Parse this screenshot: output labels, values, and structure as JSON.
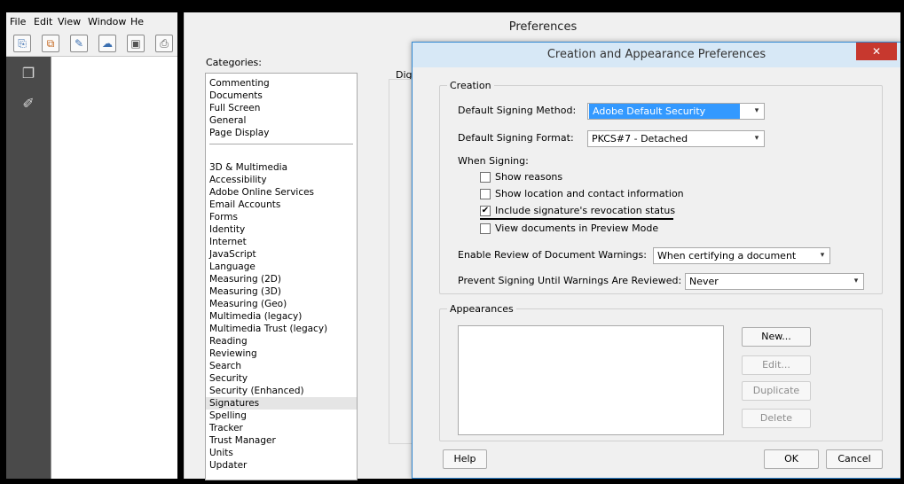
{
  "menu": {
    "file": "File",
    "edit": "Edit",
    "view": "View",
    "window": "Window",
    "help": "He"
  },
  "preferences": {
    "title": "Preferences",
    "categories_label": "Categories:",
    "digital_label": "Dig",
    "categories_top": [
      "Commenting",
      "Documents",
      "Full Screen",
      "General",
      "Page Display"
    ],
    "categories": [
      "3D & Multimedia",
      "Accessibility",
      "Adobe Online Services",
      "Email Accounts",
      "Forms",
      "Identity",
      "Internet",
      "JavaScript",
      "Language",
      "Measuring (2D)",
      "Measuring (3D)",
      "Measuring (Geo)",
      "Multimedia (legacy)",
      "Multimedia Trust (legacy)",
      "Reading",
      "Reviewing",
      "Search",
      "Security",
      "Security (Enhanced)",
      "Signatures",
      "Spelling",
      "Tracker",
      "Trust Manager",
      "Units",
      "Updater"
    ],
    "selected_category": "Signatures"
  },
  "dialog": {
    "title": "Creation and Appearance Preferences",
    "close": "✕",
    "creation": {
      "legend": "Creation",
      "default_signing_method_label": "Default Signing Method:",
      "default_signing_method_value": "Adobe Default Security",
      "default_signing_format_label": "Default Signing Format:",
      "default_signing_format_value": "PKCS#7 - Detached",
      "when_signing_label": "When Signing:",
      "options": [
        {
          "label": "Show reasons",
          "checked": false
        },
        {
          "label": "Show location and contact information",
          "checked": false
        },
        {
          "label": "Include signature's revocation status",
          "checked": true
        },
        {
          "label": "View documents in Preview Mode",
          "checked": false
        }
      ],
      "enable_review_label": "Enable Review of Document Warnings:",
      "enable_review_value": "When certifying a document",
      "prevent_signing_label": "Prevent Signing Until Warnings Are Reviewed:",
      "prevent_signing_value": "Never"
    },
    "appearances": {
      "legend": "Appearances",
      "new_button": "New...",
      "edit_button": "Edit...",
      "duplicate_button": "Duplicate",
      "delete_button": "Delete"
    },
    "help_button": "Help",
    "ok_button": "OK",
    "cancel_button": "Cancel"
  },
  "icons": {
    "arrow": "▾",
    "check": "✔"
  },
  "colors": {
    "selection_blue": "#3399ff",
    "close_red": "#c7382e",
    "titlebar": "#d7e8f6",
    "nav_pane": "#4a4a4a"
  }
}
